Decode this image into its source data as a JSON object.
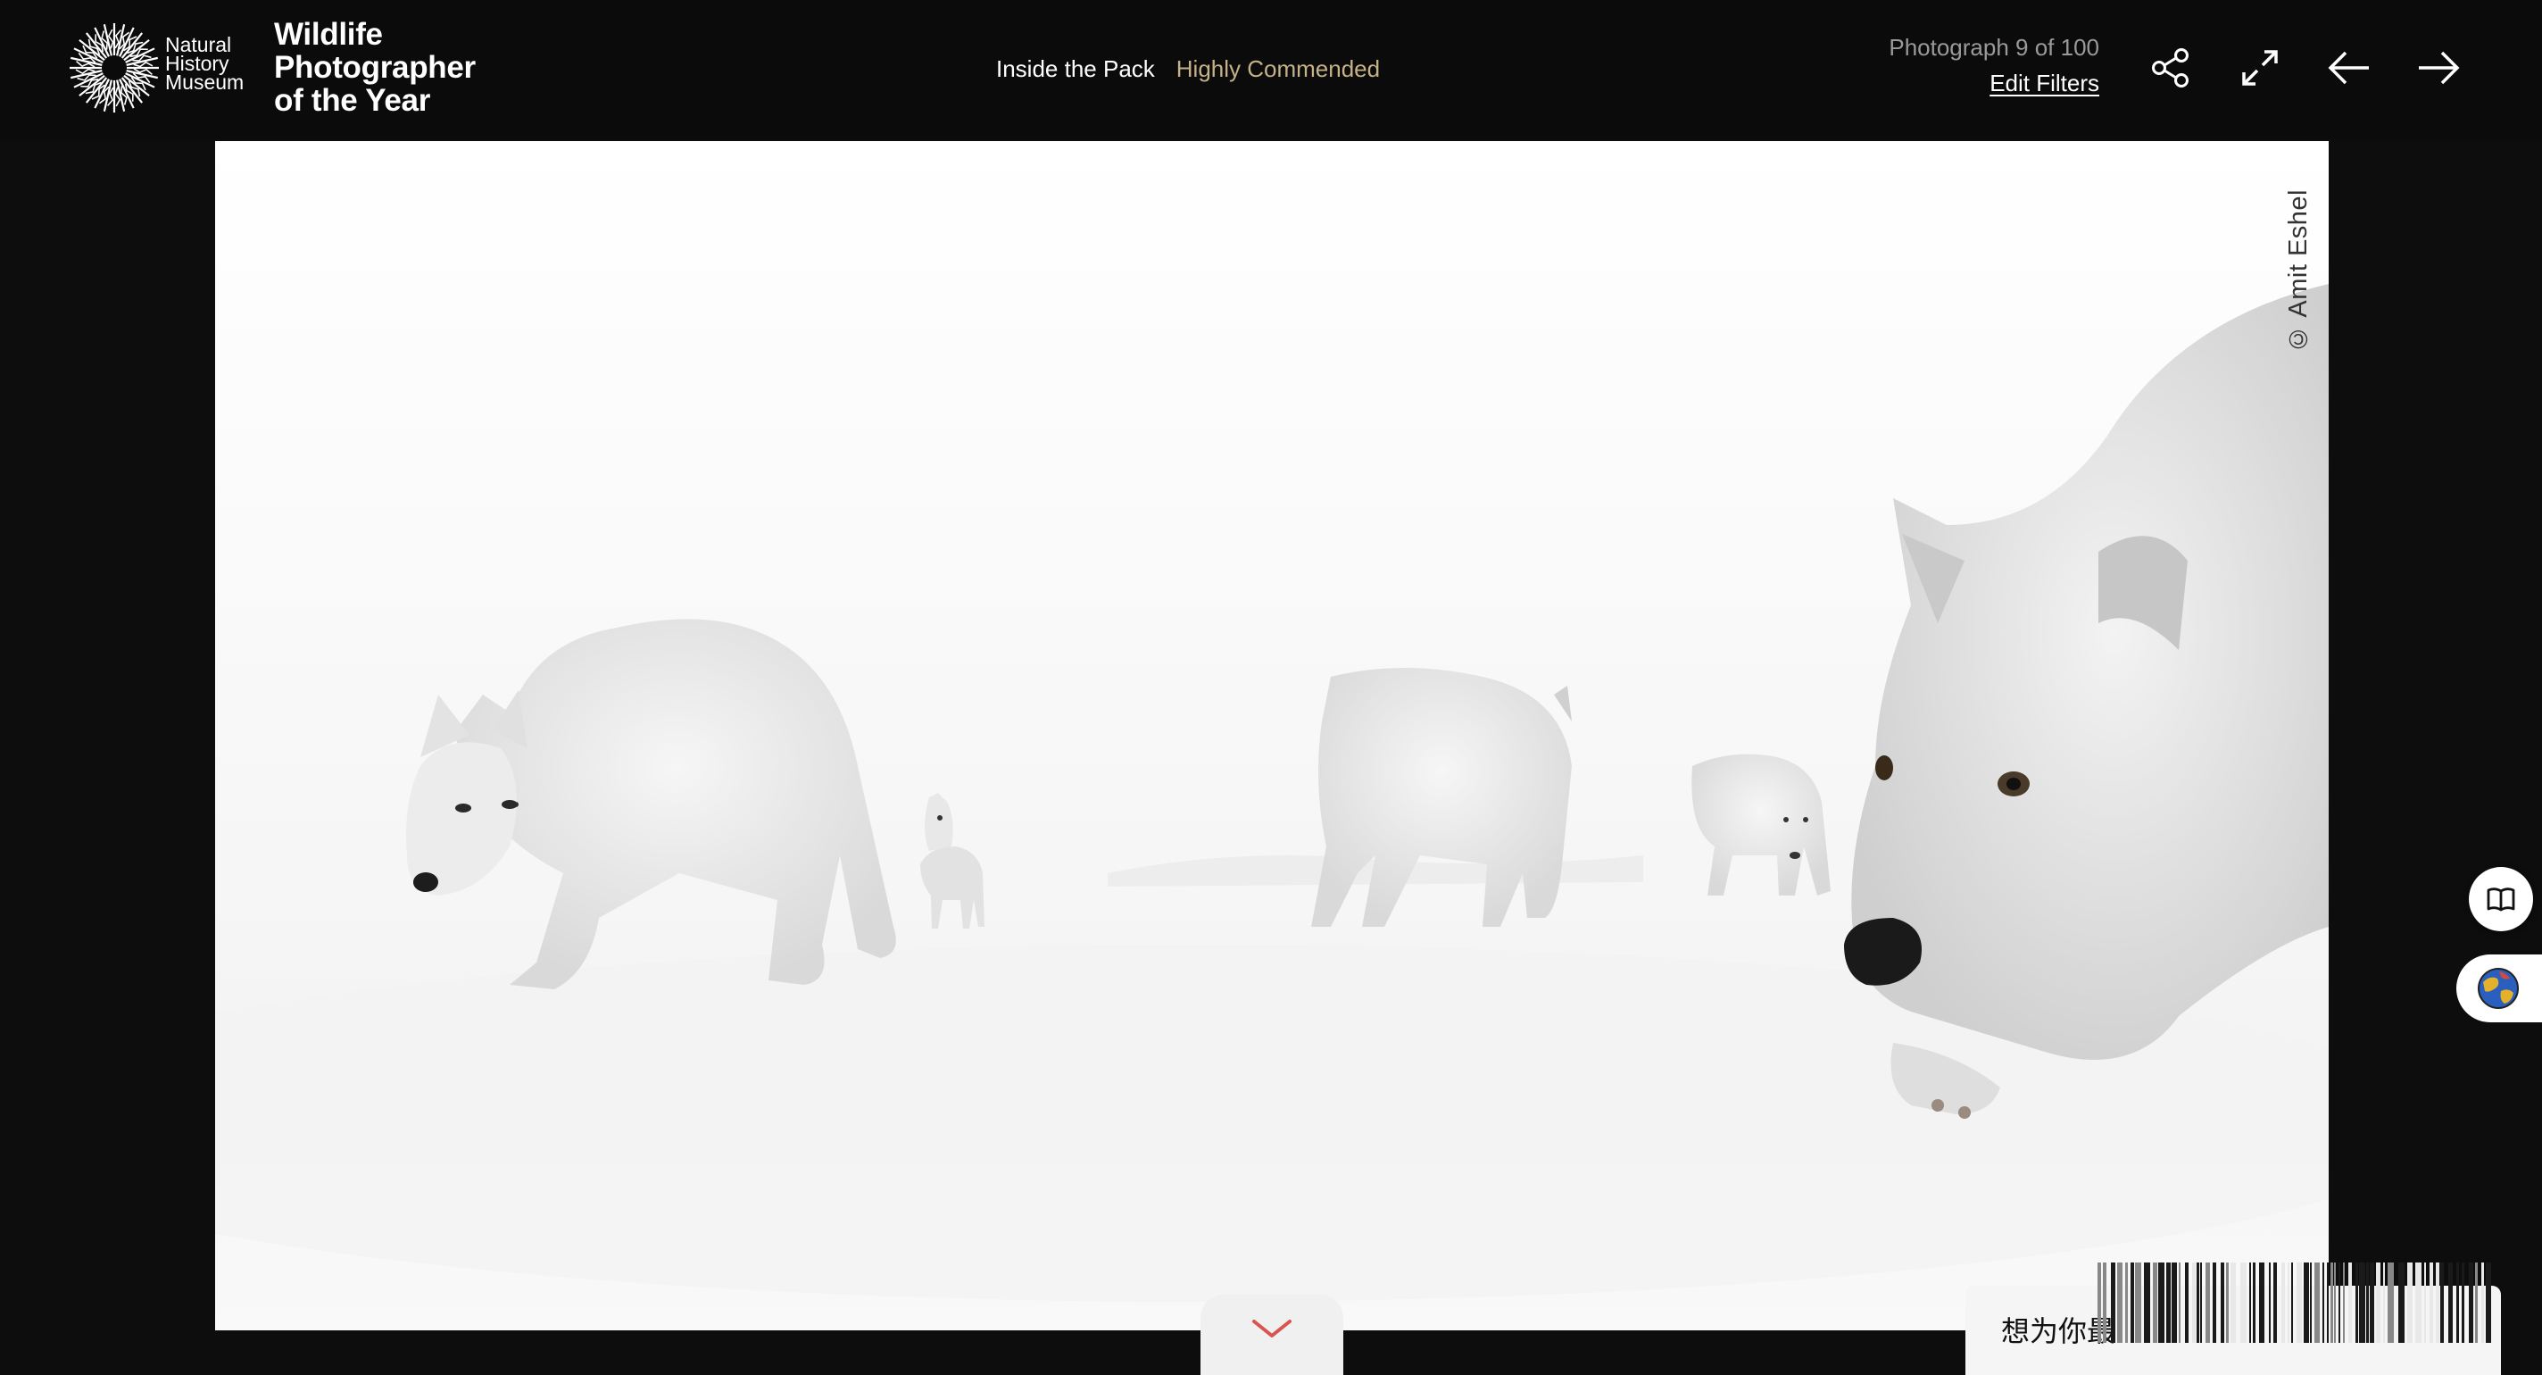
{
  "header": {
    "logo": {
      "label": "Natural History Museum",
      "lines": [
        "Natural",
        "History",
        "Museum"
      ]
    },
    "site_title_lines": [
      "Wildlife",
      "Photographer",
      "of the Year"
    ],
    "image_title": "Inside the Pack",
    "award": "Highly Commended",
    "counter": "Photograph 9 of 100",
    "edit_filters": "Edit Filters",
    "icons": [
      "share-icon",
      "fullscreen-icon",
      "arrow-left-icon",
      "arrow-right-icon"
    ]
  },
  "photo": {
    "credit": "© Amit Eshel",
    "subject": "arctic wolves in snow"
  },
  "side_buttons": [
    "book-icon",
    "globe-icon"
  ],
  "scroll_down_icon": "chevron-down-icon",
  "chat": {
    "text": "想为你最"
  },
  "colors": {
    "background": "#0b0b0b",
    "award": "#c5b287",
    "accent_chevron": "#d9534f"
  }
}
